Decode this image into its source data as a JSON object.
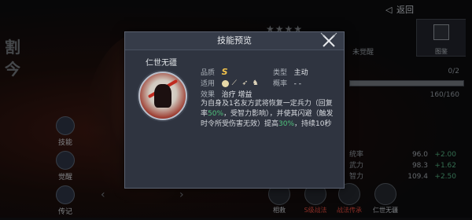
{
  "background": {
    "calligraphy": "割今",
    "back_label": "返回",
    "side_tab_label": "图鉴",
    "stars": "★★★★",
    "left_menu": [
      {
        "label": "技能",
        "icon": "skill-icon"
      },
      {
        "label": "觉醒",
        "icon": "awaken-icon"
      },
      {
        "label": "传记",
        "icon": "biography-icon"
      }
    ],
    "right_panel": {
      "unlock_text": "未觉醒",
      "progress_text": "0/2",
      "exp_text": "160/160",
      "stats": [
        {
          "label": "统率",
          "value": "96.0",
          "delta": "+2.00"
        },
        {
          "label": "武力",
          "value": "98.3",
          "delta": "+1.62"
        },
        {
          "label": "智力",
          "value": "109.4",
          "delta": "+2.50"
        }
      ]
    },
    "bottom_skills": [
      {
        "label": "相救",
        "color": "white"
      },
      {
        "label": "S级战法",
        "color": "red"
      },
      {
        "label": "战法传承",
        "color": "red"
      },
      {
        "label": "仁世无疆",
        "color": "white"
      }
    ]
  },
  "modal": {
    "title": "技能预览",
    "skill_name": "仁世无疆",
    "quality_label": "品质",
    "quality_value": "S",
    "type_label": "类型",
    "type_value": "主动",
    "applicable_label": "适用",
    "chance_label": "概率",
    "chance_value": "- -",
    "effect_label": "效果",
    "effect_value": "治疗  增益",
    "description_parts": [
      {
        "text": "为自身及1名友方武将恢复一定兵力（回复率",
        "color": "normal"
      },
      {
        "text": "50%",
        "color": "green"
      },
      {
        "text": "，受智力影响），并使其闪避（触发时令所受伤害无效）提高",
        "color": "normal"
      },
      {
        "text": "30%",
        "color": "green"
      },
      {
        "text": "，持续10秒",
        "color": "normal"
      }
    ]
  }
}
